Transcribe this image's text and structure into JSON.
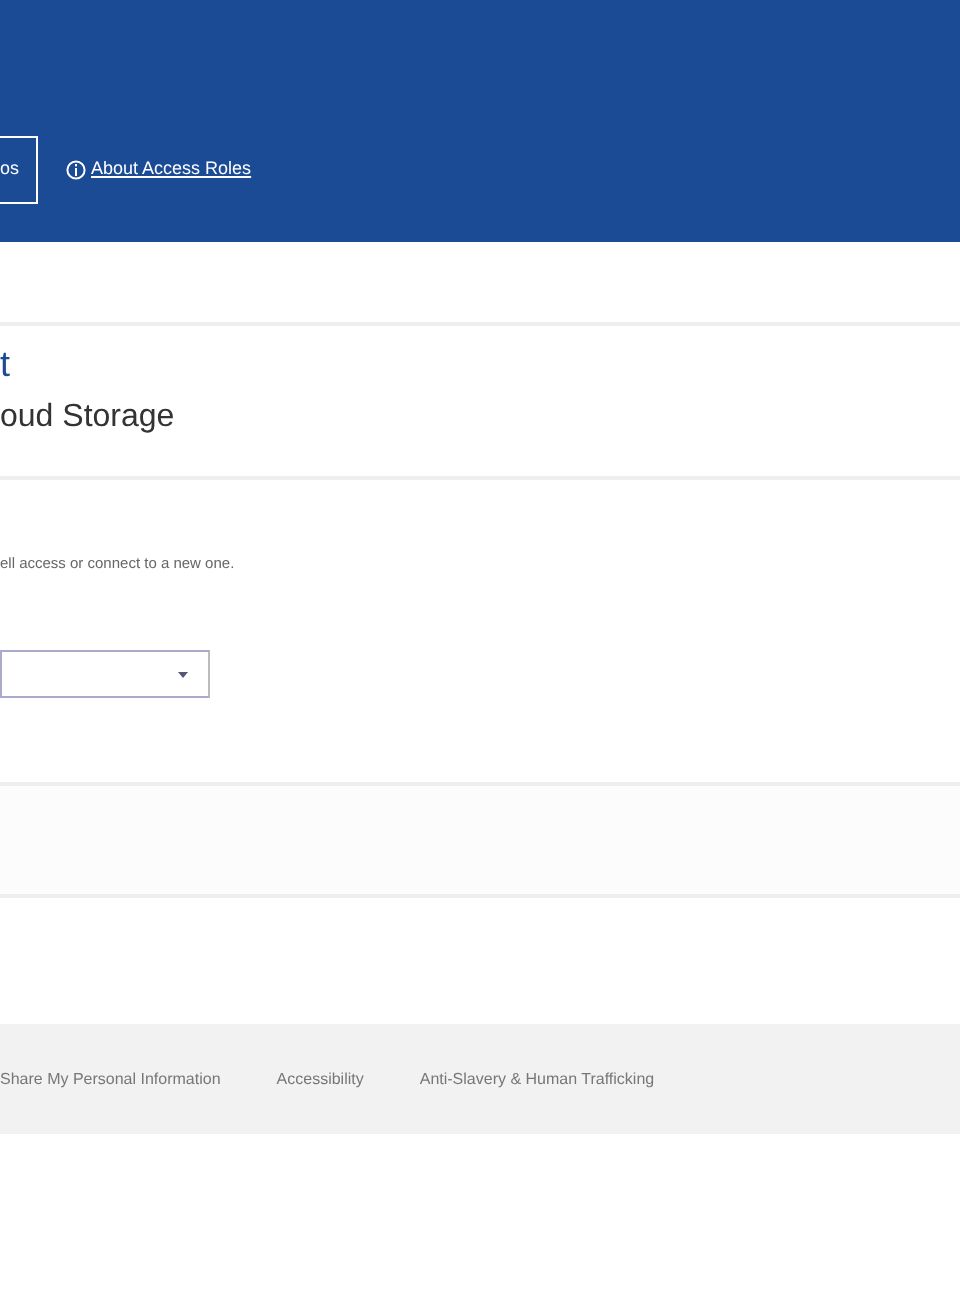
{
  "header": {
    "button": "os",
    "link": "About Access Roles"
  },
  "section": {
    "title": "t",
    "subtitle": "oud Storage"
  },
  "body": {
    "text": "ell access or connect to a new one.",
    "select": {
      "expanded": false
    }
  },
  "footer": {
    "links": [
      "Share My Personal Information",
      "Accessibility",
      "Anti-Slavery & Human Trafficking"
    ]
  }
}
